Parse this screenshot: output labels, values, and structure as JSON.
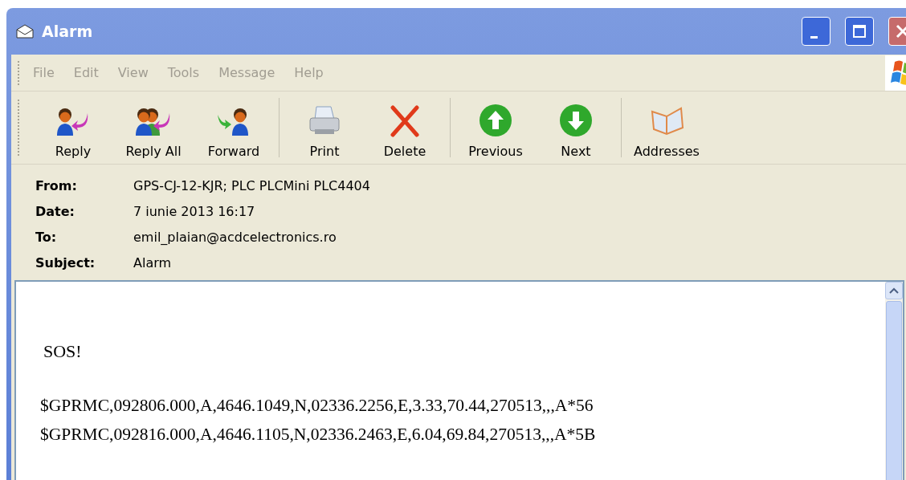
{
  "window": {
    "title": "Alarm"
  },
  "menu": [
    {
      "label": "File",
      "disabled": true
    },
    {
      "label": "Edit",
      "disabled": true
    },
    {
      "label": "View",
      "disabled": true
    },
    {
      "label": "Tools",
      "disabled": true
    },
    {
      "label": "Message",
      "disabled": true
    },
    {
      "label": "Help",
      "disabled": true
    }
  ],
  "toolbar": [
    {
      "kind": "reply",
      "label": "Reply"
    },
    {
      "kind": "reply_all",
      "label": "Reply All"
    },
    {
      "kind": "forward",
      "label": "Forward"
    },
    {
      "kind": "separator"
    },
    {
      "kind": "print",
      "label": "Print"
    },
    {
      "kind": "delete",
      "label": "Delete"
    },
    {
      "kind": "separator"
    },
    {
      "kind": "previous",
      "label": "Previous"
    },
    {
      "kind": "next",
      "label": "Next"
    },
    {
      "kind": "separator"
    },
    {
      "kind": "addresses",
      "label": "Addresses"
    }
  ],
  "header": [
    {
      "label": "From:",
      "value": "GPS-CJ-12-KJR; PLC PLCMini PLC4404"
    },
    {
      "label": "Date:",
      "value": "7 iunie 2013 16:17"
    },
    {
      "label": "To:",
      "value": "emil_plaian@acdcelectronics.ro"
    },
    {
      "label": "Subject:",
      "value": "Alarm"
    }
  ],
  "body": {
    "greeting": "SOS!",
    "lines": [
      "$GPRMC,092806.000,A,4646.1049,N,02336.2256,E,3.33,70.44,270513,,,A*56",
      "$GPRMC,092816.000,A,4646.1105,N,02336.2463,E,6.04,69.84,270513,,,A*5B"
    ]
  }
}
